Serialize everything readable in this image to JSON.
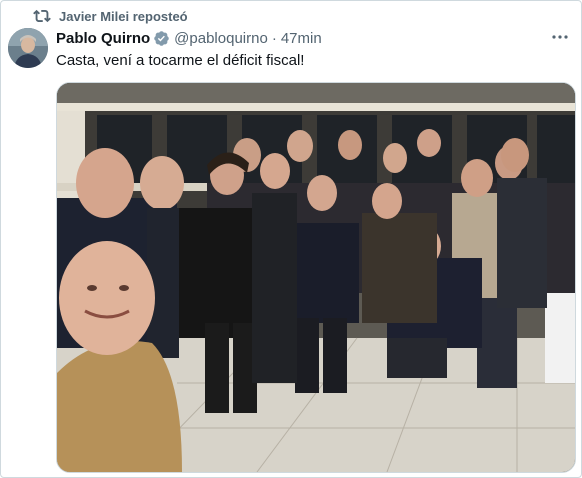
{
  "repost": {
    "text": "Javier Milei reposteó",
    "icon": "repost-icon"
  },
  "tweet": {
    "author_name": "Pablo Quirno",
    "handle": "@pabloquirno",
    "separator": "·",
    "time": "47min",
    "text": "Casta, vení a tocarme el déficit fiscal!",
    "verified_icon": "verified-badge-icon",
    "more_icon": "more-options-icon"
  },
  "media": {
    "kind": "group-selfie-photo"
  },
  "colors": {
    "text_primary": "#0f1419",
    "text_secondary": "#536471",
    "verified": "#829aab",
    "border": "#cfd9de"
  }
}
